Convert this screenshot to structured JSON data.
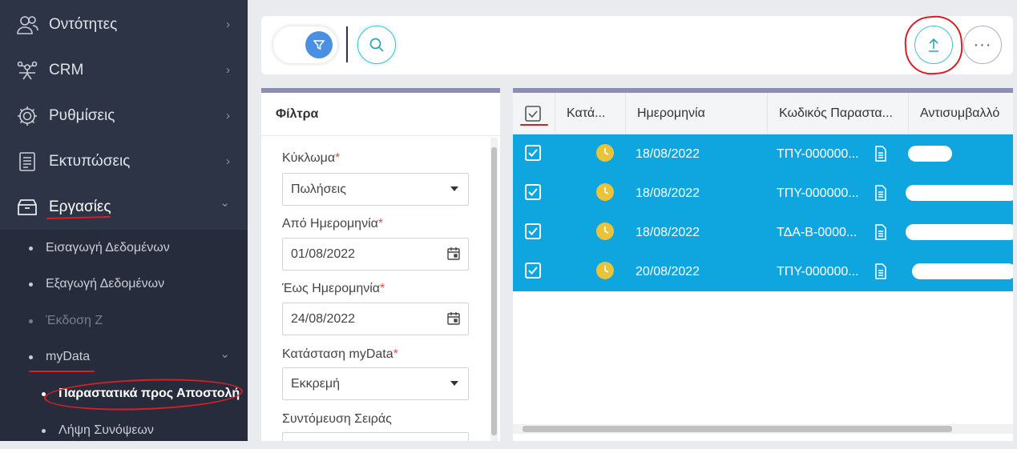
{
  "sidebar": {
    "items": [
      {
        "label": "Οντότητες",
        "icon": "users-icon"
      },
      {
        "label": "CRM",
        "icon": "crm-icon"
      },
      {
        "label": "Ρυθμίσεις",
        "icon": "gear-icon"
      },
      {
        "label": "Εκτυπώσεις",
        "icon": "document-list-icon"
      },
      {
        "label": "Εργασίες",
        "icon": "archive-box-icon"
      }
    ],
    "sub_items": [
      {
        "label": "Εισαγωγή Δεδομένων"
      },
      {
        "label": "Εξαγωγή Δεδομένων"
      },
      {
        "label": "Έκδοση Ζ"
      },
      {
        "label": "myData"
      },
      {
        "label": "Παραστατικά προς Αποστολή"
      },
      {
        "label": "Λήψη Συνόψεων"
      }
    ],
    "chevron_right": "›",
    "chevron_down": "⌄"
  },
  "toolbar": {
    "filter_icon": "filter-icon",
    "search_icon": "search-icon",
    "upload_icon": "upload-icon",
    "more_label": "···"
  },
  "filters": {
    "title": "Φίλτρα",
    "fields": [
      {
        "label": "Κύκλωμα",
        "required": "*",
        "value": "Πωλήσεις",
        "type": "select"
      },
      {
        "label": "Από Ημερομηνία",
        "required": "*",
        "value": "01/08/2022",
        "type": "date"
      },
      {
        "label": "Έως Ημερομηνία",
        "required": "*",
        "value": "24/08/2022",
        "type": "date"
      },
      {
        "label": "Κατάσταση myData",
        "required": "*",
        "value": "Εκκρεμή",
        "type": "select"
      },
      {
        "label": "Συντόμευση Σειράς",
        "required": "",
        "value": "",
        "type": "text"
      }
    ]
  },
  "grid": {
    "columns": [
      "Κατά...",
      "Ημερομηνία",
      "Κωδικός Παραστα...",
      "Αντισυμβαλλό"
    ],
    "rows": [
      {
        "date": "18/08/2022",
        "code": "ΤΠΥ-000000..."
      },
      {
        "date": "18/08/2022",
        "code": "ΤΠΥ-000000..."
      },
      {
        "date": "18/08/2022",
        "code": "ΤΔΑ-Β-0000..."
      },
      {
        "date": "20/08/2022",
        "code": "ΤΠΥ-000000..."
      }
    ]
  },
  "colors": {
    "sidebar_bg": "#2d3446",
    "accent": "#0fa6e0",
    "teal": "#3cc0c6",
    "annotation_red": "#d61f26"
  }
}
